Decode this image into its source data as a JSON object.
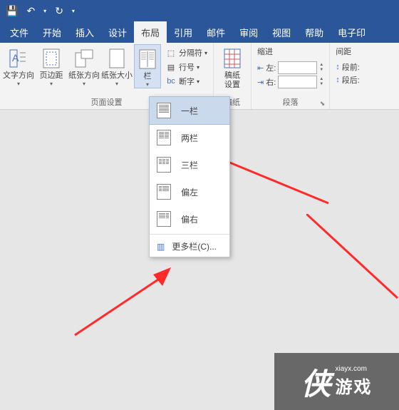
{
  "titlebar": {
    "save": "💾",
    "undo": "↶",
    "redo": "↻"
  },
  "tabs": [
    "文件",
    "开始",
    "插入",
    "设计",
    "布局",
    "引用",
    "邮件",
    "审阅",
    "视图",
    "帮助",
    "电子印"
  ],
  "active_tab_index": 4,
  "groups": {
    "page_setup": {
      "label": "页面设置",
      "text_direction": "文字方向",
      "margins": "页边距",
      "orientation": "纸张方向",
      "size": "纸张大小",
      "columns": "栏",
      "breaks": "分隔符",
      "line_numbers": "行号",
      "hyphenation": "断字"
    },
    "manuscript": {
      "label": "稿纸",
      "btn": "稿纸\n设置"
    },
    "indent": {
      "label": "缩进",
      "left": "左:",
      "right": "右:",
      "left_val": "",
      "right_val": ""
    },
    "spacing": {
      "label": "间距",
      "before": "段前:",
      "after": "段后:"
    },
    "para_label": "段落"
  },
  "columns_menu": {
    "one": "一栏",
    "two": "两栏",
    "three": "三栏",
    "left": "偏左",
    "right": "偏右",
    "more": "更多栏(C)..."
  },
  "watermark": {
    "url": "xiayx.com",
    "text": "游戏"
  }
}
